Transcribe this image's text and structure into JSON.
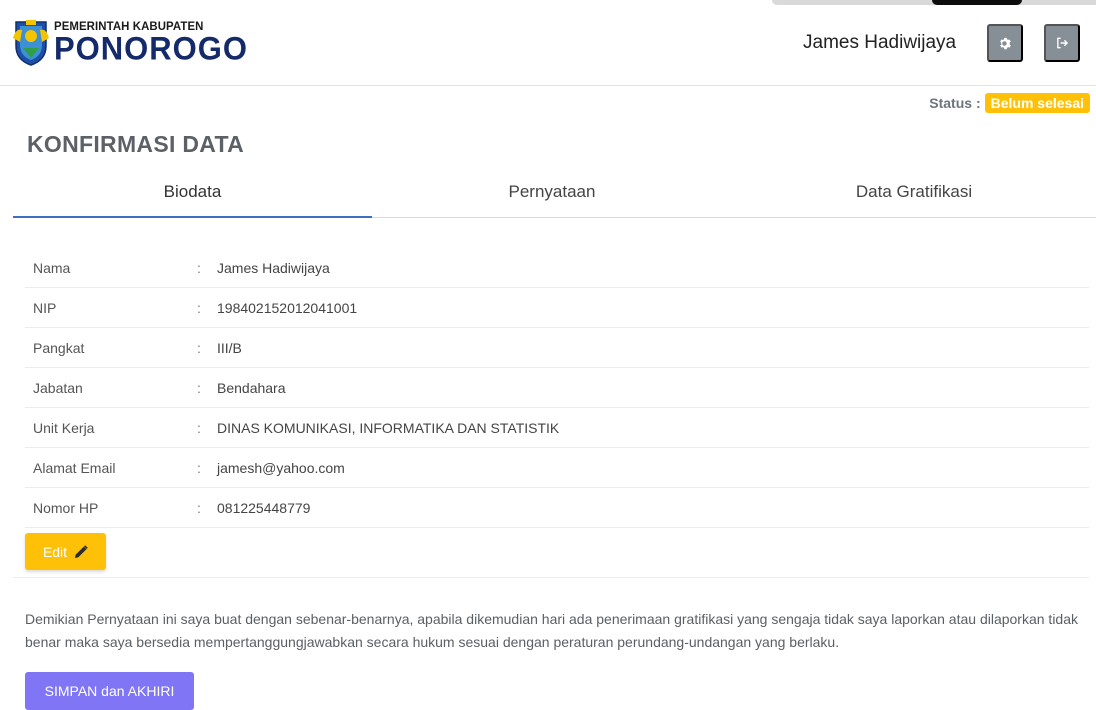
{
  "header": {
    "logo": {
      "subtitle": "PEMERINTAH KABUPATEN",
      "title": "PONOROGO"
    },
    "user_name": "James Hadiwijaya",
    "settings_icon": "gear-icon",
    "logout_icon": "sign-out-icon"
  },
  "status": {
    "label": "Status :",
    "value": "Belum selesai",
    "color": "#ffc107"
  },
  "page_title": "KONFIRMASI DATA",
  "tabs": [
    {
      "label": "Biodata",
      "active": true
    },
    {
      "label": "Pernyataan",
      "active": false
    },
    {
      "label": "Data Gratifikasi",
      "active": false
    }
  ],
  "biodata": [
    {
      "label": "Nama",
      "value": "James Hadiwijaya"
    },
    {
      "label": "NIP",
      "value": "198402152012041001"
    },
    {
      "label": "Pangkat",
      "value": "III/B"
    },
    {
      "label": "Jabatan",
      "value": "Bendahara"
    },
    {
      "label": "Unit Kerja",
      "value": "DINAS KOMUNIKASI, INFORMATIKA DAN STATISTIK"
    },
    {
      "label": "Alamat Email",
      "value": "jamesh@yahoo.com"
    },
    {
      "label": "Nomor HP",
      "value": "081225448779"
    }
  ],
  "separator": ":",
  "edit_button": {
    "label": "Edit",
    "icon": "pencil-icon",
    "color": "#ffc107"
  },
  "statement": "Demikian Pernyataan ini saya buat dengan sebenar-benarnya, apabila dikemudian hari ada penerimaan gratifikasi yang sengaja tidak saya laporkan atau dilaporkan tidak benar maka saya bersedia mempertanggungjawabkan secara hukum sesuai dengan peraturan perundang-undangan yang berlaku.",
  "submit_button": {
    "label": "SIMPAN dan AKHIRI",
    "color": "#8075f5"
  },
  "accent_color": "#3c6fc1"
}
